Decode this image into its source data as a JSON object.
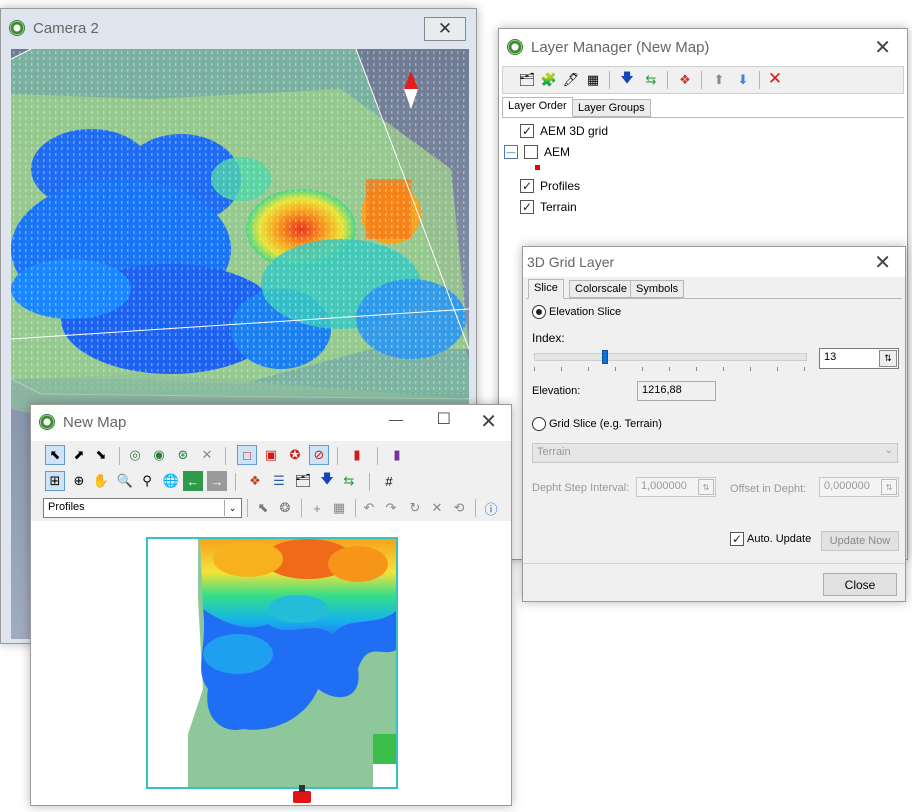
{
  "camera": {
    "title": "Camera 2",
    "close_glyph": "✕"
  },
  "layer_manager": {
    "title": "Layer Manager (New Map)",
    "close_glyph": "✕",
    "tabs": [
      "Layer Order",
      "Layer Groups"
    ],
    "layers": [
      {
        "label": "AEM 3D grid",
        "checked": true
      },
      {
        "label": "AEM",
        "checked": false,
        "expander": "—"
      },
      {
        "label": "Profiles",
        "checked": true
      },
      {
        "label": "Terrain",
        "checked": true
      }
    ],
    "toolbar_icons": [
      "add-layer-icon",
      "layer-props-icon",
      "layer-edit-icon",
      "layer-table-icon",
      "move-down-icon",
      "refresh-icon",
      "layer-color-icon",
      "arrow-up-icon",
      "arrow-down-icon",
      "delete-layer-icon"
    ]
  },
  "grid_layer": {
    "title": "3D Grid Layer",
    "close_glyph": "✕",
    "tabs": [
      "Slice",
      "Colorscale",
      "Symbols"
    ],
    "elevation_slice_label": "Elevation Slice",
    "index_label": "Index:",
    "index_value": "13",
    "slider_position": 0.26,
    "elevation_label": "Elevation:",
    "elevation_value": "1216,88",
    "grid_slice_label": "Grid Slice (e.g. Terrain)",
    "grid_dropdown_value": "Terrain",
    "depth_step_label": "Depht Step Interval:",
    "depth_step_value": "1,000000",
    "offset_label": "Offset in Depht:",
    "offset_value": "0,000000",
    "auto_update_label": "Auto. Update",
    "auto_update_checked": true,
    "update_now_label": "Update Now",
    "close_button_label": "Close"
  },
  "new_map": {
    "title": "New Map",
    "minimize_glyph": "—",
    "maximize_glyph": "☐",
    "close_glyph": "✕",
    "layer_select_value": "Profiles",
    "toolbar_icons_row1": [
      "pointer-icon",
      "select-lasso-icon",
      "select-box-icon",
      "zoom-extent-icon",
      "zoom-prev-icon",
      "zoom-next-icon",
      "clear-icon",
      "rect-tool-icon",
      "rect-zoom-icon",
      "settings-icon",
      "no-entry-icon",
      "red-marker-icon",
      "purple-marker-icon"
    ],
    "toolbar_icons_row2": [
      "zoom-window-icon",
      "zoom-in-icon",
      "pan-hand-icon",
      "zoom-icon",
      "magnifier-icon",
      "globe-icon",
      "back-arrow-icon",
      "forward-arrow-icon",
      "layer-color-icon",
      "layers-icon",
      "edit-layer-icon",
      "move-down-icon",
      "refresh-icon",
      "grid-icon"
    ],
    "toolbar_icons_row3": [
      "select-add-icon",
      "select-multi-icon",
      "add-point-icon",
      "table-icon",
      "undo-icon",
      "redo-icon",
      "rotate-icon",
      "delete-icon",
      "reset-icon",
      "info-icon"
    ]
  }
}
